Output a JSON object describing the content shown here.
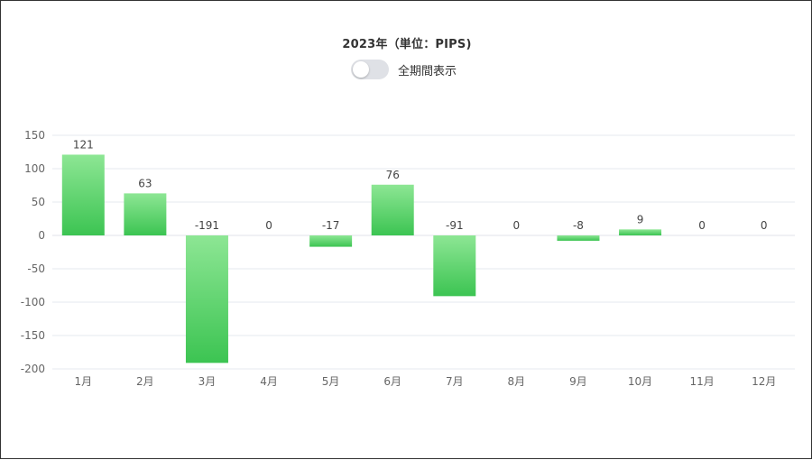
{
  "chart_data": {
    "type": "bar",
    "title": "2023年（単位：PIPS)",
    "categories": [
      "1月",
      "2月",
      "3月",
      "4月",
      "5月",
      "6月",
      "7月",
      "8月",
      "9月",
      "10月",
      "11月",
      "12月"
    ],
    "values": [
      121,
      63,
      -191,
      0,
      -17,
      76,
      -91,
      0,
      -8,
      9,
      0,
      0
    ],
    "value_labels": [
      "121",
      "63",
      "-191",
      "0",
      "-17",
      "76",
      "-91",
      "0",
      "-8",
      "9",
      "0",
      "0"
    ],
    "ylim": [
      -200,
      150
    ],
    "yticks": [
      150,
      100,
      50,
      0,
      -50,
      -100,
      -150,
      -200
    ],
    "ytick_labels": [
      "150",
      "100",
      "50",
      "0",
      "-50",
      "-100",
      "-150",
      "-200"
    ],
    "xlabel": "",
    "ylabel": "",
    "grid": true,
    "legend": "none",
    "bar_color_top": "#8de694",
    "bar_color_bottom": "#3cc452"
  },
  "toggle": {
    "label": "全期間表示",
    "checked": false
  }
}
